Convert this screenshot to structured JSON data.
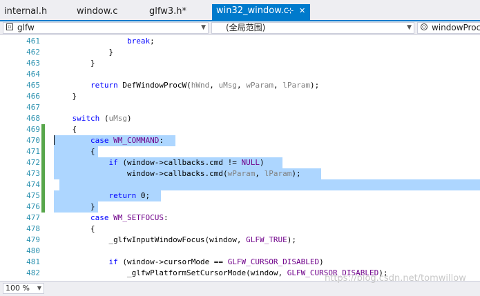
{
  "tabs": [
    {
      "label": "internal.h"
    },
    {
      "label": "window.c"
    },
    {
      "label": "glfw3.h*"
    },
    {
      "label": "win32_window.c",
      "pin_glyph": "⊹",
      "close_glyph": "✕"
    }
  ],
  "nav": {
    "project": "glfw",
    "scope": "(全局范围)",
    "member": "windowProc"
  },
  "lines": [
    {
      "num": "461",
      "code": "                break;"
    },
    {
      "num": "462",
      "code": "            }"
    },
    {
      "num": "463",
      "code": "        }"
    },
    {
      "num": "464",
      "code": ""
    },
    {
      "num": "465",
      "code": "        return DefWindowProcW(hWnd, uMsg, wParam, lParam);"
    },
    {
      "num": "466",
      "code": "    }"
    },
    {
      "num": "467",
      "code": ""
    },
    {
      "num": "468",
      "code": "    switch (uMsg)"
    },
    {
      "num": "469",
      "code": "    {"
    },
    {
      "num": "470",
      "code": "        case WM_COMMAND:"
    },
    {
      "num": "471",
      "code": "        {"
    },
    {
      "num": "472",
      "code": "            if (window->callbacks.cmd != NULL)"
    },
    {
      "num": "473",
      "code": "                window->callbacks.cmd(wParam, lParam);"
    },
    {
      "num": "474",
      "code": ""
    },
    {
      "num": "475",
      "code": "            return 0;"
    },
    {
      "num": "476",
      "code": "        }"
    },
    {
      "num": "477",
      "code": "        case WM_SETFOCUS:"
    },
    {
      "num": "478",
      "code": "        {"
    },
    {
      "num": "479",
      "code": "            _glfwInputWindowFocus(window, GLFW_TRUE);"
    },
    {
      "num": "480",
      "code": ""
    },
    {
      "num": "481",
      "code": "            if (window->cursorMode == GLFW_CURSOR_DISABLED)"
    },
    {
      "num": "482",
      "code": "                _glfwPlatformSetCursorMode(window, GLFW_CURSOR_DISABLED);"
    }
  ],
  "status": {
    "zoom": "100 %"
  },
  "watermark": "https://blog.csdn.net/tomwillow",
  "colors": {
    "accent": "#007acc",
    "selection": "#add6ff",
    "keyword": "#0000ff",
    "macro": "#6f008a",
    "param": "#808080",
    "line_number": "#2b91af",
    "change_bar": "#57a64a"
  }
}
